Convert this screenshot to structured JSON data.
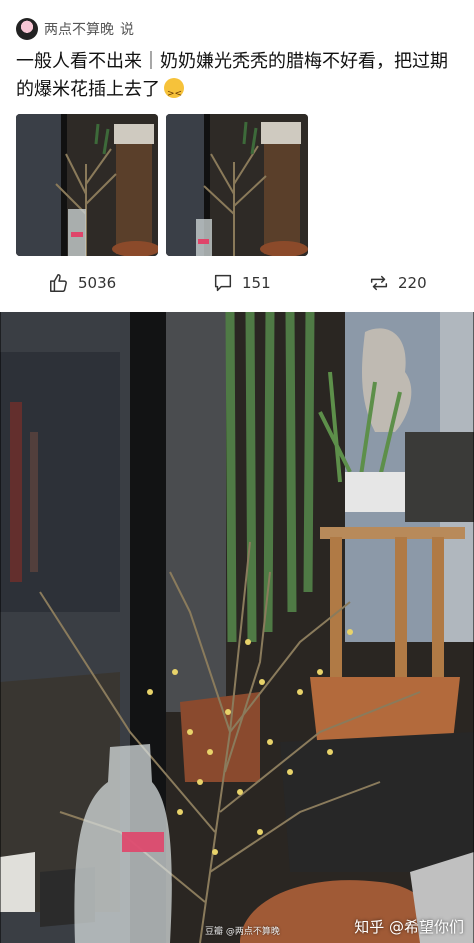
{
  "post": {
    "author": "两点不算晚",
    "said": "说",
    "text": "一般人看不出来｜奶奶嫌光秃秃的腊梅不好看，把过期的爆米花插上去了",
    "emoji_icon": "squinting-tongue-emoji"
  },
  "actions": {
    "likes": "5036",
    "comments": "151",
    "reposts": "220"
  },
  "watermarks": {
    "main": "知乎 @希望你们",
    "small": "豆瓣 @两点不算晚"
  }
}
